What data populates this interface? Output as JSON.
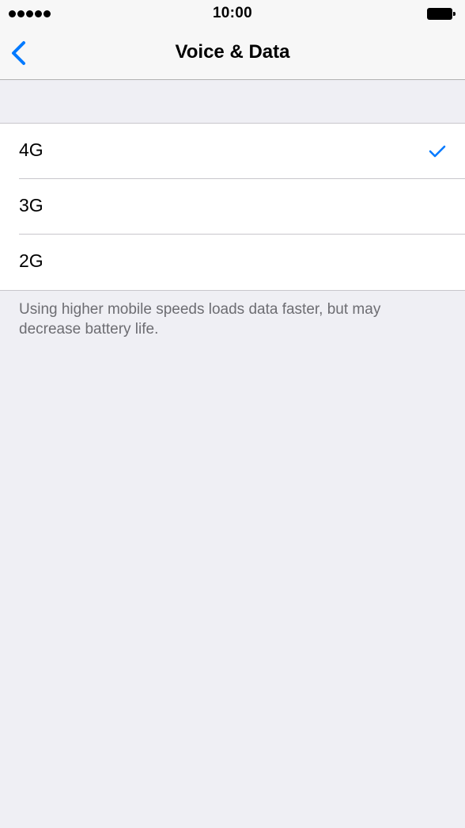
{
  "status_bar": {
    "time": "10:00",
    "signal_dots": 5
  },
  "nav": {
    "title": "Voice & Data",
    "back_icon": "chevron-left-icon"
  },
  "options": [
    {
      "label": "4G",
      "selected": true
    },
    {
      "label": "3G",
      "selected": false
    },
    {
      "label": "2G",
      "selected": false
    }
  ],
  "footer": {
    "note": "Using higher mobile speeds loads data faster, but may decrease battery life."
  },
  "colors": {
    "accent": "#007aff",
    "background": "#efeff4",
    "footer_text": "#6d6d72",
    "separator": "#c8c7cc"
  }
}
